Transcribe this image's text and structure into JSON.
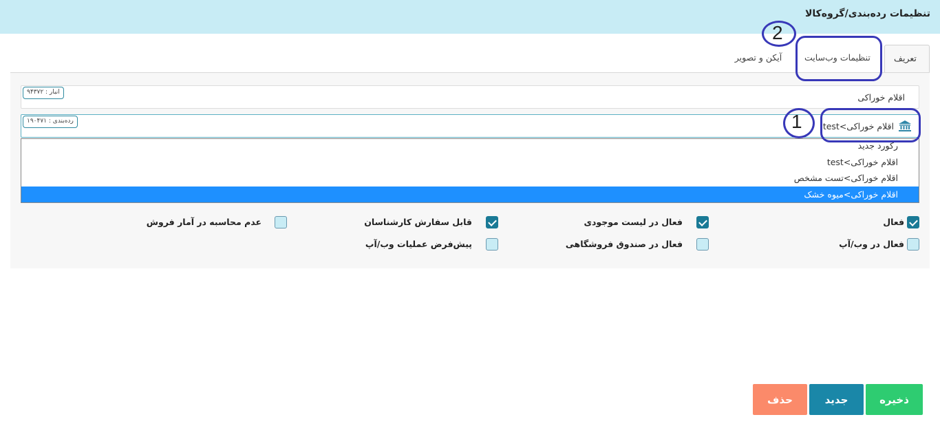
{
  "header": {
    "title": "تنظیمات رده‌بندی/گروه‌کالا"
  },
  "tabs": [
    {
      "label": "تعریف",
      "active": true
    },
    {
      "label": "تنظیمات وب‌سایت",
      "active": false
    },
    {
      "label": "آیکن و تصویر",
      "active": false
    }
  ],
  "fields": {
    "warehouse": {
      "value": "اقلام خوراکی",
      "badge": "انبار : ۹۴۳۷۲"
    },
    "category": {
      "value": "اقلام خوراکی>test",
      "badge": "رده‌بندی : ۱۹۰۴۷۱",
      "icon": "bank-icon"
    }
  },
  "annotations": {
    "one": "1",
    "two": "2"
  },
  "dropdown": {
    "items": [
      {
        "label": "رکورد جدید",
        "selected": false
      },
      {
        "label": "اقلام خوراکی>test",
        "selected": false
      },
      {
        "label": "اقلام خوراکی>تست مشخص",
        "selected": false
      },
      {
        "label": "اقلام خوراکی>میوه خشک",
        "selected": true
      }
    ]
  },
  "checkboxes": {
    "active": {
      "label": "فعال",
      "checked": true
    },
    "active_inventory": {
      "label": "فعال در لیست موجودی",
      "checked": true
    },
    "expert_order": {
      "label": "قابل سفارش کارشناسان",
      "checked": true
    },
    "exclude_sales_stats": {
      "label": "عدم محاسبه در آمار فروش",
      "checked": false
    },
    "active_webapp": {
      "label": "فعال در وب/آپ",
      "checked": false
    },
    "active_store_cash": {
      "label": "فعال در صندوق فروشگاهی",
      "checked": false
    },
    "default_webapp_ops": {
      "label": "پیش‌فرض عملیات وب/آپ",
      "checked": false
    }
  },
  "buttons": {
    "save": "ذخیره",
    "new": "جدید",
    "delete": "حذف"
  },
  "colors": {
    "header_bg": "#c8ecf5",
    "save": "#2ecc71",
    "new": "#1a87a8",
    "delete": "#fb8a6a",
    "annotation": "#3838b8",
    "selected": "#1e90ff"
  }
}
